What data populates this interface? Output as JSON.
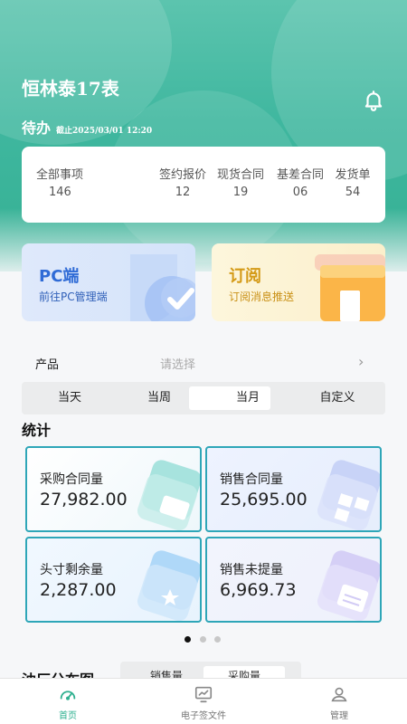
{
  "header": {
    "company": "恒林泰17表",
    "todo_title": "待办",
    "todo_deadline": "截止2025/03/01 12:20"
  },
  "todo_stats": [
    {
      "label": "全部事项",
      "value": "146"
    },
    {
      "label": "签约报价",
      "value": "12"
    },
    {
      "label": "现货合同",
      "value": "19"
    },
    {
      "label": "基差合同",
      "value": "06"
    },
    {
      "label": "发货单",
      "value": "54"
    }
  ],
  "quick_links": {
    "pc": {
      "title": "PC端",
      "subtitle": "前往PC管理端"
    },
    "subscribe": {
      "title": "订阅",
      "subtitle": "订阅消息推送"
    }
  },
  "product_filter": {
    "label": "产品",
    "placeholder": "请选择"
  },
  "period_tabs": [
    "当天",
    "当周",
    "当月",
    "自定义"
  ],
  "period_active": "当月",
  "stats_title": "统计",
  "metrics": [
    {
      "label": "采购合同量",
      "value": "27,982.00"
    },
    {
      "label": "销售合同量",
      "value": "25,695.00"
    },
    {
      "label": "头寸剩余量",
      "value": "2,287.00"
    },
    {
      "label": "销售未提量",
      "value": "6,969.73"
    }
  ],
  "pager": {
    "count": 3,
    "active_index": 0
  },
  "distribution": {
    "title": "油厂分布图",
    "tabs": [
      "销售量",
      "采购量"
    ],
    "active": "采购量"
  },
  "tabbar": [
    {
      "label": "首页",
      "icon": "gauge-icon",
      "active": true
    },
    {
      "label": "电子签文件",
      "icon": "chart-monitor-icon",
      "active": false
    },
    {
      "label": "管理",
      "icon": "user-icon",
      "active": false
    }
  ],
  "colors": {
    "brand": "#35b093",
    "metric_border": "#2ea6b8",
    "pc_blue": "#2f6bd6",
    "subscribe_gold": "#d49a17"
  }
}
